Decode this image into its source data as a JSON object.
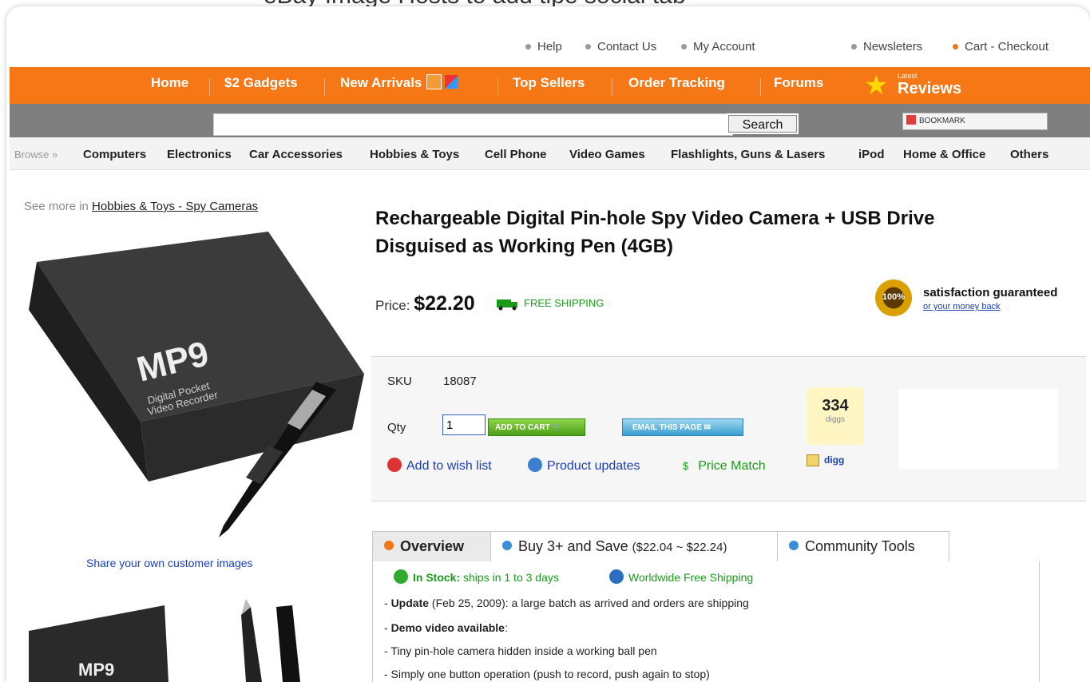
{
  "top_caption": "eBay Image Hosts to add tipe social tab ",
  "toplinks": {
    "help": "Help",
    "contact": "Contact Us",
    "account": "My Account",
    "newsletters": "Newsleters",
    "cart": "Cart - Checkout"
  },
  "nav": {
    "items": [
      "Home",
      "$2 Gadgets",
      "New Arrivals",
      "Top Sellers",
      "Order Tracking",
      "Forums"
    ],
    "reviews_small": "Latest",
    "reviews": "Reviews"
  },
  "search": {
    "value": "",
    "button": "Search",
    "bookmark": "BOOKMARK"
  },
  "browse": {
    "label": "Browse »",
    "categories": [
      "Computers",
      "Electronics",
      "Car Accessories",
      "Hobbies & Toys",
      "Cell Phone",
      "Video Games",
      "Flashlights, Guns & Lasers",
      "iPod",
      "Home & Office",
      "Others"
    ]
  },
  "left": {
    "see_more_prefix": "See more in",
    "see_more_link": "Hobbies & Toys - Spy Cameras",
    "box_brand": "MP9",
    "box_sub1": "Digital Pocket",
    "box_sub2": "Video Recorder",
    "share": "Share your own customer images"
  },
  "product": {
    "title_line1": "Rechargeable Digital Pin-hole Spy Video Camera + USB Drive",
    "title_line2": "Disguised as Working Pen (4GB)",
    "price_label": "Price:",
    "price": "$22.20",
    "free_shipping": "FREE SHIPPING",
    "guarantee_badge": "100%",
    "guarantee": "satisfaction guaranteed",
    "guarantee_sub": "or your money back"
  },
  "details": {
    "sku_label": "SKU",
    "sku": "18087",
    "qty_label": "Qty",
    "qty": "1",
    "add_to_cart": "ADD TO CART",
    "email_page": "EMAIL THIS PAGE",
    "wishlist": "Add to wish list",
    "updates": "Product updates",
    "price_match_icon": "$",
    "price_match": "Price Match",
    "digg_count": "334",
    "digg_label": "diggs",
    "digg_button": "digg"
  },
  "tabs": {
    "overview": "Overview",
    "buy3": "Buy 3+ and Save",
    "buy3_range": "($22.04 ~ $22.24)",
    "community": "Community Tools"
  },
  "overview": {
    "instock_bold": "In Stock:",
    "instock_rest": " ships in 1 to 3 days",
    "worldwide": "Worldwide Free Shipping",
    "update_prefix": "- ",
    "update_bold": "Update",
    "update_rest": " (Feb 25, 2009): a large batch as arrived and orders are shipping",
    "demo_prefix": "- ",
    "demo_bold": "Demo video available",
    "demo_rest": ":",
    "bullet1": "- Tiny pin-hole camera hidden inside a working ball pen",
    "bullet2": "- Simply one button operation (push to record, push again to stop)"
  },
  "colors": {
    "nav_orange": "#f57716",
    "grey_bar": "#7f7f7f",
    "link_blue": "#1a3fb8",
    "green": "#1a9a1a"
  }
}
